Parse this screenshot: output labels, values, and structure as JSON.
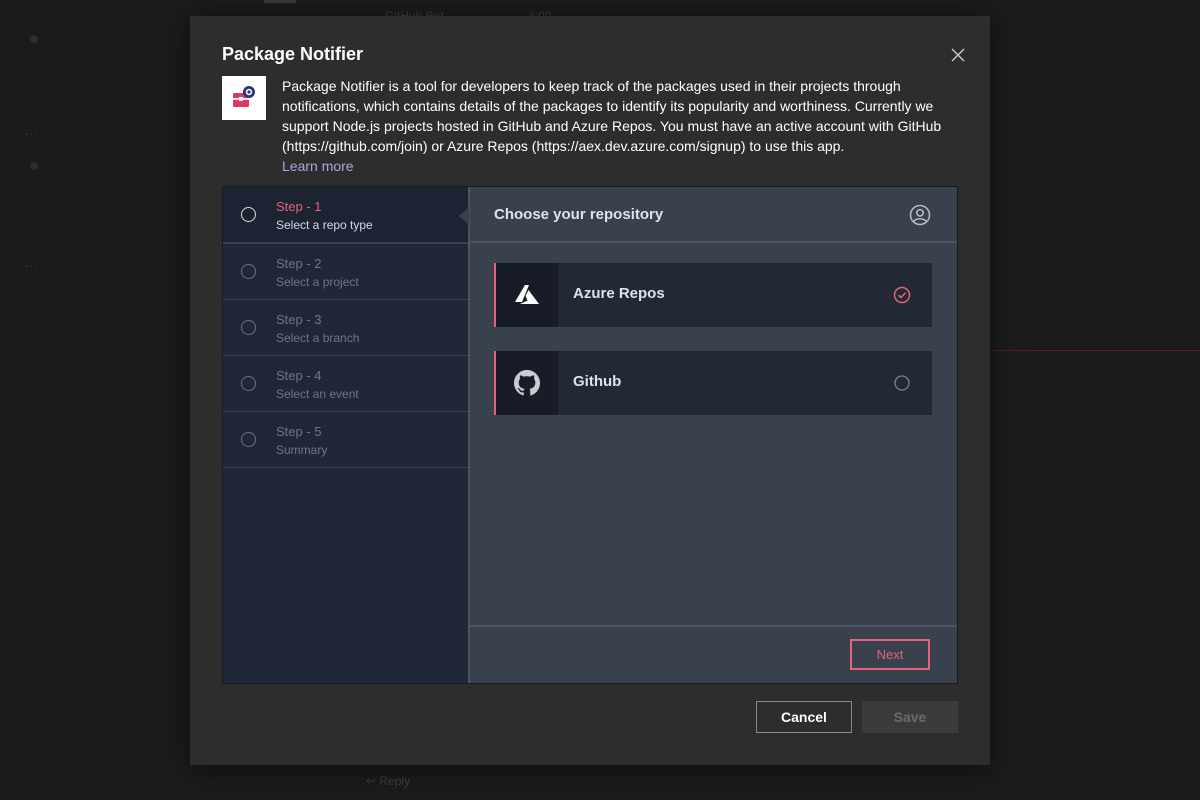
{
  "background": {
    "top_text": "GitHub Bot",
    "top_text_2": "4:00",
    "reply_text": "Reply",
    "ellipsis": "..."
  },
  "dialog": {
    "title": "Package Notifier",
    "description": "Package Notifier is a tool for developers to keep track of the packages used in their projects through notifications, which contains details of the packages to identify its popularity and worthiness. Currently we support Node.js projects hosted in GitHub and Azure Repos. You must have an active account with GitHub (https://github.com/join) or Azure Repos (https://aex.dev.azure.com/signup) to use this app.",
    "learn_more": "Learn more",
    "cancel_label": "Cancel",
    "save_label": "Save"
  },
  "wizard": {
    "steps": [
      {
        "title": "Step - 1",
        "subtitle": "Select a repo type",
        "active": true
      },
      {
        "title": "Step - 2",
        "subtitle": "Select a project",
        "active": false
      },
      {
        "title": "Step - 3",
        "subtitle": "Select a branch",
        "active": false
      },
      {
        "title": "Step - 4",
        "subtitle": "Select an event",
        "active": false
      },
      {
        "title": "Step - 5",
        "subtitle": "Summary",
        "active": false
      }
    ],
    "panel_title": "Choose your repository",
    "repos": [
      {
        "label": "Azure Repos",
        "icon": "azure-logo-icon",
        "selected": true
      },
      {
        "label": "Github",
        "icon": "github-logo-icon",
        "selected": false
      }
    ],
    "next_label": "Next"
  },
  "colors": {
    "accent": "#e5627a",
    "link": "#a6a7e8",
    "panel": "#39414f",
    "steps_bg": "#202838",
    "dialog_bg": "#2d2d2d"
  }
}
